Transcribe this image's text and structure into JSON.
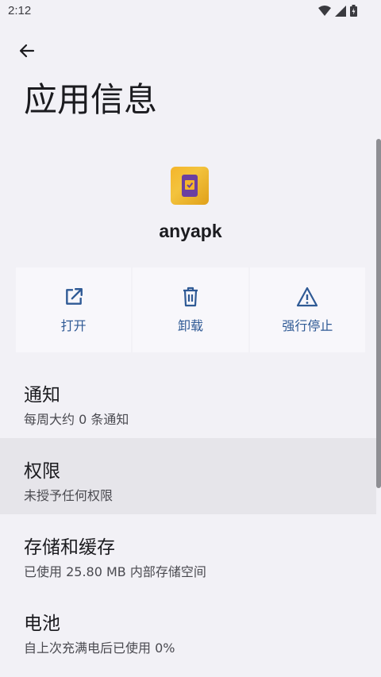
{
  "status": {
    "time": "2:12"
  },
  "page": {
    "title": "应用信息"
  },
  "app": {
    "name": "anyapk"
  },
  "actions": [
    {
      "label": "打开",
      "icon": "open-external-icon"
    },
    {
      "label": "卸载",
      "icon": "trash-icon"
    },
    {
      "label": "强行停止",
      "icon": "warning-icon"
    }
  ],
  "settings": [
    {
      "title": "通知",
      "subtitle": "每周大约 0 条通知"
    },
    {
      "title": "权限",
      "subtitle": "未授予任何权限"
    },
    {
      "title": "存储和缓存",
      "subtitle": "已使用 25.80 MB 内部存储空间"
    },
    {
      "title": "电池",
      "subtitle": "自上次充满电后已使用 0%"
    }
  ],
  "colors": {
    "accent": "#2f5a95",
    "background": "#f2f1f6",
    "app_icon": "#f4b52b",
    "app_icon_inner": "#6b3fa0"
  }
}
